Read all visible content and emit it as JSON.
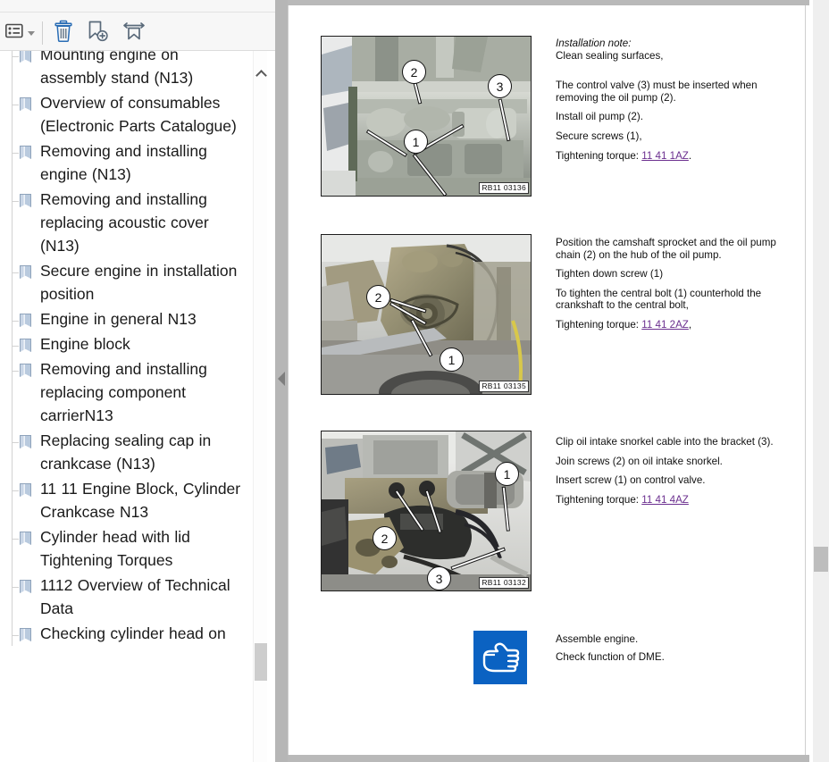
{
  "app": {
    "name": "pdf-reader",
    "accent_color": "#0b62c2",
    "link_color": "#6b2f8f"
  },
  "sidebar": {
    "toolbar": {
      "options_label": "Bookmark options",
      "options_icon": "list-options-icon",
      "dropdown_icon": "chevron-down-icon",
      "delete_label": "Delete bookmark",
      "delete_icon": "trash-icon",
      "add_label": "New bookmark",
      "add_icon": "add-bookmark-icon",
      "expand_label": "Expand current bookmark",
      "expand_icon": "expand-bookmark-icon"
    },
    "scroll": {
      "up_arrow_icon": "chevron-up-icon",
      "thumb_label": "bookmark-scroll-thumb"
    },
    "items": [
      {
        "label": "Mounting engine on assembly stand (N13)",
        "icon": "bookmark-icon",
        "partial": true
      },
      {
        "label": "Overview of consumables (Electronic Parts Catalogue)",
        "icon": "bookmark-icon"
      },
      {
        "label": "Removing and installing engine (N13)",
        "icon": "bookmark-icon"
      },
      {
        "label": "Removing and installing replacing acoustic cover (N13)",
        "icon": "bookmark-icon"
      },
      {
        "label": "Secure engine in installation position",
        "icon": "bookmark-icon"
      },
      {
        "label": "Engine in general N13",
        "icon": "bookmark-icon"
      },
      {
        "label": "Engine block",
        "icon": "bookmark-icon"
      },
      {
        "label": "Removing and installing replacing component carrierN13",
        "icon": "bookmark-icon"
      },
      {
        "label": "Replacing sealing cap in crankcase (N13)",
        "icon": "bookmark-icon"
      },
      {
        "label": "11 11 Engine Block, Cylinder Crankcase N13",
        "icon": "bookmark-icon"
      },
      {
        "label": "Cylinder head with lid Tightening Torques",
        "icon": "bookmark-icon"
      },
      {
        "label": "1112 Overview of Technical Data",
        "icon": "bookmark-icon"
      },
      {
        "label": "Checking cylinder head on",
        "icon": "bookmark-icon",
        "partial": true
      }
    ]
  },
  "splitter": {
    "collapse_icon": "collapse-left-icon"
  },
  "document": {
    "scroll": {
      "thumb_label": "document-scroll-thumb"
    },
    "sections": [
      {
        "figure": {
          "label": "RB11 03136",
          "callouts": [
            "2",
            "3",
            "1"
          ]
        },
        "text": {
          "heading": "Installation note:",
          "heading_line2": "Clean sealing surfaces,",
          "paragraphs": [
            "The control valve (3) must be inserted when removing the oil pump (2).",
            "Install oil pump (2).",
            "Secure screws (1),"
          ],
          "torque_prefix": "Tightening torque: ",
          "torque_link": "11 41 1AZ",
          "torque_suffix": "."
        }
      },
      {
        "figure": {
          "label": "RB11 03135",
          "callouts": [
            "2",
            "1"
          ]
        },
        "text": {
          "paragraphs": [
            "Position the camshaft sprocket and the oil pump chain (2) on the hub of the oil pump.",
            "Tighten down screw (1)",
            "To tighten the central bolt (1) counterhold the crankshaft to the central bolt,"
          ],
          "torque_prefix": "Tightening torque: ",
          "torque_link": "11 41 2AZ",
          "torque_suffix": ","
        }
      },
      {
        "figure": {
          "label": "RB11 03132",
          "callouts": [
            "1",
            "2",
            "3"
          ]
        },
        "text": {
          "paragraphs": [
            "Clip oil intake snorkel cable into the bracket (3).",
            "Join screws (2) on oil intake snorkel.",
            "Insert screw (1) on control valve."
          ],
          "torque_prefix": "Tightening torque: ",
          "torque_link": "11 41 4AZ",
          "torque_suffix": ""
        }
      }
    ],
    "note": {
      "icon": "pointing-hand-icon",
      "lines": [
        "Assemble engine.",
        "Check function of DME."
      ]
    }
  }
}
